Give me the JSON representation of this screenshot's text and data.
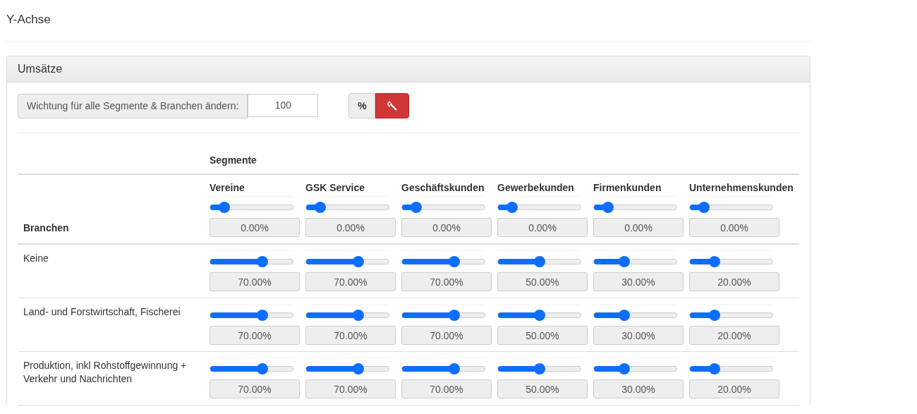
{
  "page_title": "Y-Achse",
  "panel": {
    "title": "Umsätze",
    "weight_control": {
      "label": "Wichtung für alle Segmente & Branchen ändern:",
      "value": "100",
      "unit": "%"
    },
    "table": {
      "group_heading": "Segmente",
      "row_heading": "Branchen",
      "segments": [
        {
          "name": "Vereine",
          "level": 0.17,
          "value": "0.00%"
        },
        {
          "name": "GSK Service",
          "level": 0.17,
          "value": "0.00%"
        },
        {
          "name": "Geschäftskunden",
          "level": 0.17,
          "value": "0.00%"
        },
        {
          "name": "Gewerbekunden",
          "level": 0.17,
          "value": "0.00%"
        },
        {
          "name": "Firmenkunden",
          "level": 0.17,
          "value": "0.00%"
        },
        {
          "name": "Unternehmenskunden",
          "level": 0.17,
          "value": "0.00%"
        }
      ],
      "rows": [
        {
          "name": "Keine",
          "cells": [
            {
              "level": 0.63,
              "value": "70.00%"
            },
            {
              "level": 0.63,
              "value": "70.00%"
            },
            {
              "level": 0.63,
              "value": "70.00%"
            },
            {
              "level": 0.5,
              "value": "50.00%"
            },
            {
              "level": 0.37,
              "value": "30.00%"
            },
            {
              "level": 0.3,
              "value": "20.00%"
            }
          ]
        },
        {
          "name": "Land- und Forstwirtschaft, Fischerei",
          "cells": [
            {
              "level": 0.63,
              "value": "70.00%"
            },
            {
              "level": 0.63,
              "value": "70.00%"
            },
            {
              "level": 0.63,
              "value": "70.00%"
            },
            {
              "level": 0.5,
              "value": "50.00%"
            },
            {
              "level": 0.37,
              "value": "30.00%"
            },
            {
              "level": 0.3,
              "value": "20.00%"
            }
          ]
        },
        {
          "name": "Produktion, inkl Rohstoffgewinnung + Verkehr und Nachrichten",
          "cells": [
            {
              "level": 0.63,
              "value": "70.00%"
            },
            {
              "level": 0.63,
              "value": "70.00%"
            },
            {
              "level": 0.63,
              "value": "70.00%"
            },
            {
              "level": 0.5,
              "value": "50.00%"
            },
            {
              "level": 0.37,
              "value": "30.00%"
            },
            {
              "level": 0.3,
              "value": "20.00%"
            }
          ]
        }
      ]
    }
  }
}
